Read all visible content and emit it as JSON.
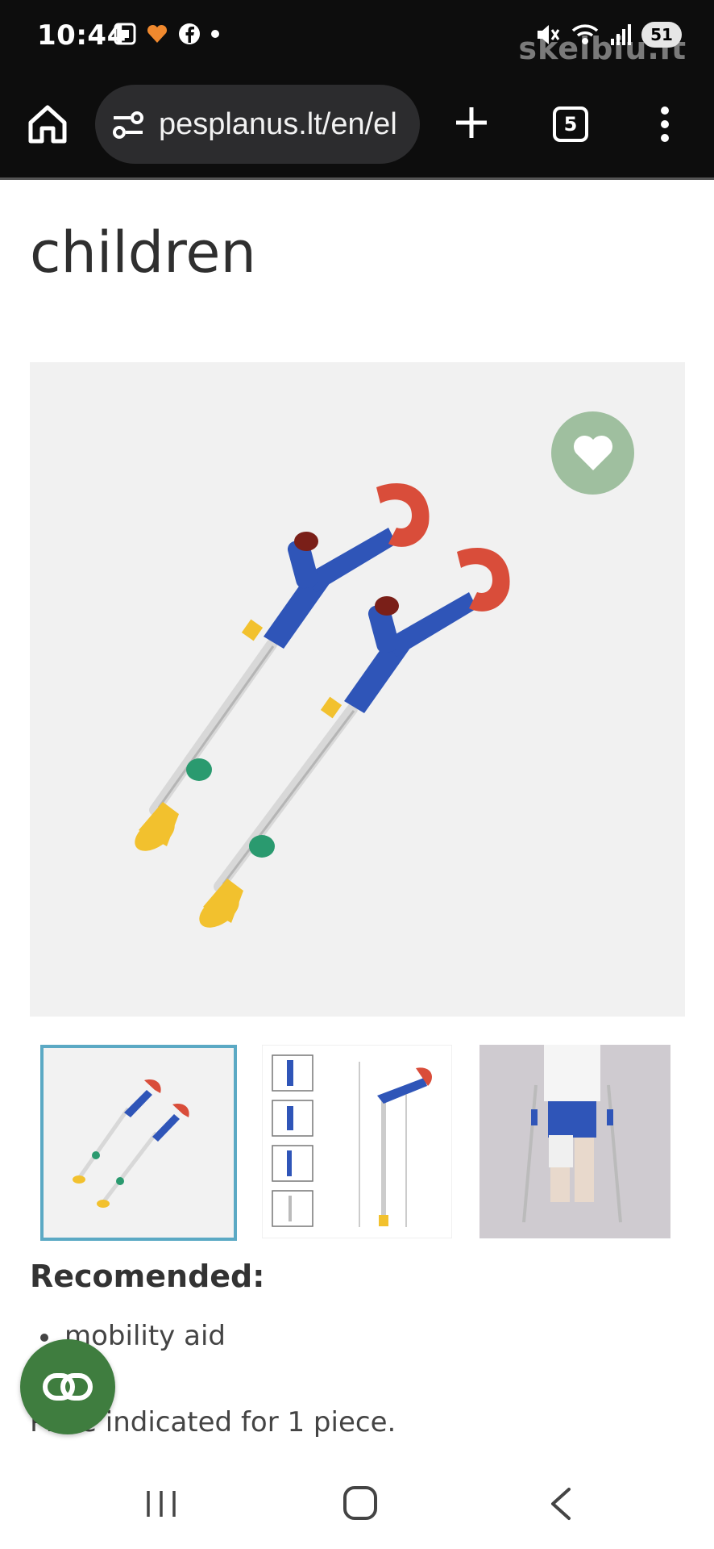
{
  "status_bar": {
    "time": "10:44",
    "battery": "51",
    "watermark": "skelbiu.lt",
    "icons": [
      "screenshot-icon",
      "health-icon",
      "facebook-icon",
      "dot-icon",
      "mute-icon",
      "wifi-icon",
      "signal-icon",
      "battery-icon"
    ]
  },
  "toolbar": {
    "url": "pesplanus.lt/en/el",
    "tab_count": "5",
    "icons": [
      "home-icon",
      "site-settings-icon",
      "new-tab-icon",
      "tabs-icon",
      "menu-icon"
    ]
  },
  "product": {
    "title": "children",
    "images": [
      "crutches-product-image",
      "crutches-dimensions-image",
      "crutches-in-use-image"
    ],
    "favorite_icon": "heart-icon",
    "recommended_heading": "Recomended:",
    "recommended_items": [
      "mobility aid"
    ],
    "price_note": "Price indicated for 1 piece."
  },
  "colors": {
    "accent_border": "#5ba9c4",
    "favorite_bg": "#9fbf9f",
    "float_btn_bg": "#3f7d3f",
    "crutch_blue": "#2f55b8",
    "crutch_red": "#d94d3a",
    "crutch_yellow": "#f2c12e",
    "crutch_green": "#2a9a6f"
  },
  "navbar": {
    "icons": [
      "recent-apps-icon",
      "home-nav-icon",
      "back-icon"
    ]
  }
}
